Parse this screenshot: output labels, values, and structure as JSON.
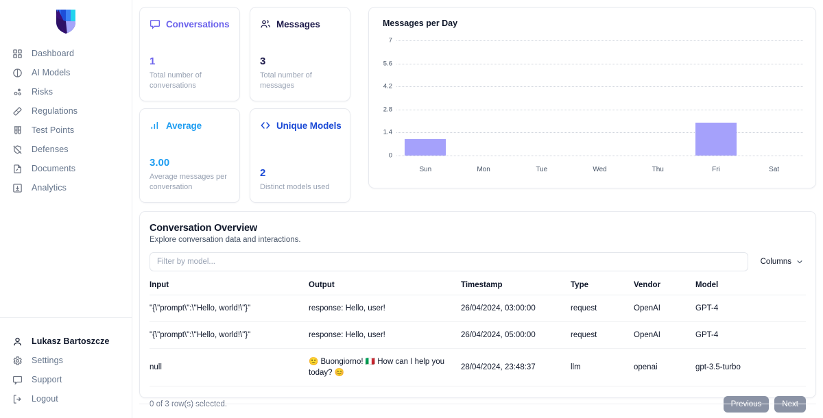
{
  "sidebar": {
    "logo_name": "vendia-shield-logo",
    "nav": [
      {
        "label": "Dashboard",
        "icon": "grid-icon"
      },
      {
        "label": "AI Models",
        "icon": "circle-half-icon"
      },
      {
        "label": "Risks",
        "icon": "molecule-icon"
      },
      {
        "label": "Regulations",
        "icon": "ruler-icon"
      },
      {
        "label": "Test Points",
        "icon": "test-tubes-icon"
      },
      {
        "label": "Defenses",
        "icon": "shield-off-icon"
      },
      {
        "label": "Documents",
        "icon": "file-icon"
      },
      {
        "label": "Analytics",
        "icon": "download-box-icon"
      }
    ],
    "bottom": [
      {
        "label": "Lukasz Bartoszcze",
        "icon": "user-icon"
      },
      {
        "label": "Settings",
        "icon": "gear-icon"
      },
      {
        "label": "Support",
        "icon": "message-square-icon"
      },
      {
        "label": "Logout",
        "icon": "logout-icon"
      }
    ]
  },
  "cards": [
    {
      "title": "Conversations",
      "icon": "message-square-icon",
      "color": "#6c63ec",
      "value": "1",
      "desc": "Total number of conversations"
    },
    {
      "title": "Messages",
      "icon": "users-icon",
      "color": "#1e1b4b",
      "value": "3",
      "desc": "Total number of messages"
    },
    {
      "title": "Average",
      "icon": "bar-chart-icon",
      "color": "#1e9df1",
      "value": "3.00",
      "desc": "Average messages per conversation"
    },
    {
      "title": "Unique Models",
      "icon": "code-brackets-icon",
      "color": "#1b4ad6",
      "value": "2",
      "desc": "Distinct models used"
    }
  ],
  "chart_data": {
    "type": "bar",
    "title": "Messages per Day",
    "categories": [
      "Sun",
      "Mon",
      "Tue",
      "Wed",
      "Thu",
      "Fri",
      "Sat"
    ],
    "values": [
      1,
      0,
      0,
      0,
      0,
      2,
      0
    ],
    "yticks": [
      0,
      1.4,
      2.8,
      4.2,
      5.6,
      7
    ],
    "ytick_labels": [
      "0",
      "1.4",
      "2.8",
      "4.2",
      "5.6",
      "7"
    ],
    "ylim": [
      0,
      7
    ],
    "xlabel": "",
    "ylabel": "",
    "grid": true,
    "legend": false,
    "bar_color": "#a5a1fb"
  },
  "panel": {
    "title": "Conversation Overview",
    "subtitle": "Explore conversation data and interactions.",
    "filter_placeholder": "Filter by model...",
    "filter_value": "",
    "columns_label": "Columns",
    "headers": [
      "Input",
      "Output",
      "Timestamp",
      "Type",
      "Vendor",
      "Model"
    ],
    "rows": [
      {
        "input": "\"{\\\"prompt\\\":\\\"Hello, world!\\\"}\"",
        "output": "response: Hello, user!",
        "timestamp": "26/04/2024, 03:00:00",
        "type": "request",
        "vendor": "OpenAI",
        "model": "GPT-4"
      },
      {
        "input": "\"{\\\"prompt\\\":\\\"Hello, world!\\\"}\"",
        "output": "response: Hello, user!",
        "timestamp": "26/04/2024, 05:00:00",
        "type": "request",
        "vendor": "OpenAI",
        "model": "GPT-4"
      },
      {
        "input": "null",
        "output": "🙂 Buongiorno! 🇮🇹 How can I help you today? 😊",
        "timestamp": "28/04/2024, 23:48:37",
        "type": "llm",
        "vendor": "openai",
        "model": "gpt-3.5-turbo"
      }
    ],
    "rows_selected": "0 of 3 row(s) selected.",
    "prev_label": "Previous",
    "next_label": "Next"
  }
}
